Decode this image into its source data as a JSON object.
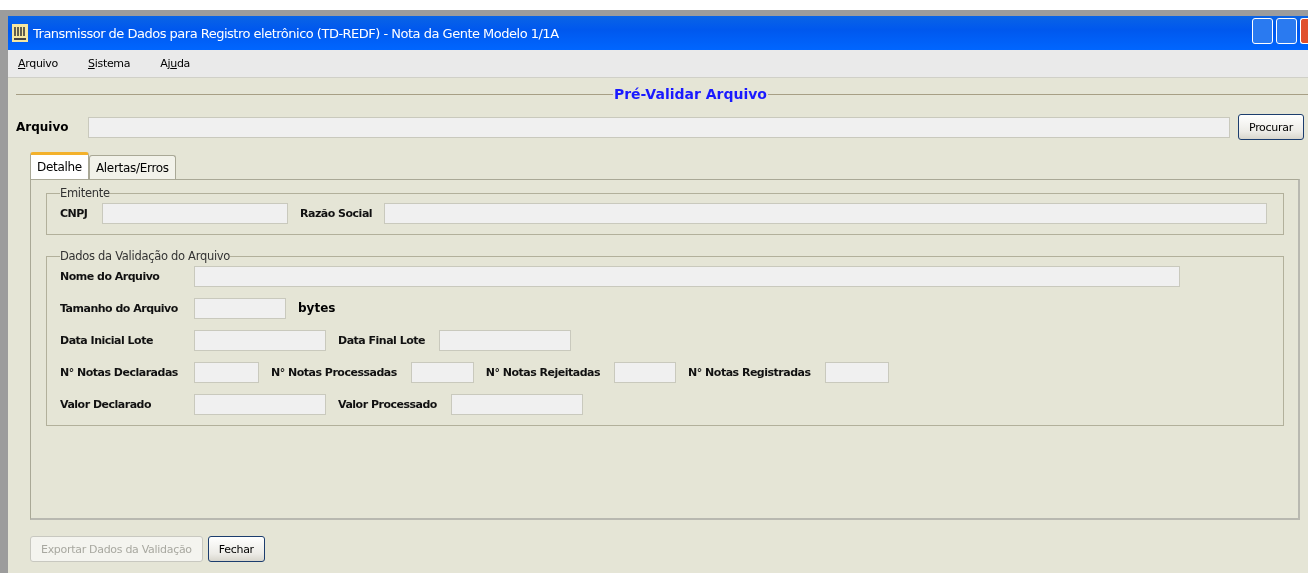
{
  "window": {
    "title": "Transmissor de Dados para Registro eletrônico (TD-REDF) - Nota da Gente Modelo 1/1A"
  },
  "menu": [
    {
      "label": "Arquivo"
    },
    {
      "label": "Sistema"
    },
    {
      "label": "Ajuda"
    }
  ],
  "panel_title": "Pré-Validar Arquivo",
  "file_row": {
    "label": "Arquivo",
    "button": "Procurar"
  },
  "tabs": [
    {
      "label": "Detalhe",
      "selected": true
    },
    {
      "label": "Alertas/Erros",
      "selected": false
    }
  ],
  "groups": [
    {
      "title": "Emitente",
      "rows": [
        [
          {
            "kind": "label",
            "text": "CNPJ"
          },
          {
            "kind": "field"
          },
          {
            "kind": "label",
            "text": "Razão Social"
          },
          {
            "kind": "field"
          }
        ]
      ]
    },
    {
      "title": "Dados da Validação do Arquivo",
      "rows": [
        [
          {
            "kind": "label",
            "text": "Nome do Arquivo"
          },
          {
            "kind": "field"
          }
        ],
        [
          {
            "kind": "label",
            "text": "Tamanho do Arquivo"
          },
          {
            "kind": "field"
          },
          {
            "kind": "unit",
            "text": "bytes"
          }
        ],
        [
          {
            "kind": "label",
            "text": "Data Inicial Lote"
          },
          {
            "kind": "field"
          },
          {
            "kind": "label",
            "text": "Data Final Lote"
          },
          {
            "kind": "field"
          }
        ],
        [
          {
            "kind": "label",
            "text": "N° Notas Declaradas"
          },
          {
            "kind": "field"
          },
          {
            "kind": "label",
            "text": "N° Notas Processadas"
          },
          {
            "kind": "field"
          },
          {
            "kind": "label",
            "text": "N° Notas Rejeitadas"
          },
          {
            "kind": "field"
          },
          {
            "kind": "label",
            "text": "N° Notas Registradas"
          },
          {
            "kind": "field"
          }
        ],
        [
          {
            "kind": "label",
            "text": "Valor Declarado"
          },
          {
            "kind": "field"
          },
          {
            "kind": "label",
            "text": "Valor Processado"
          },
          {
            "kind": "field"
          }
        ]
      ]
    }
  ],
  "buttons": [
    {
      "label": "Exportar Dados da Validação",
      "disabled": true
    },
    {
      "label": "Fechar",
      "disabled": false
    }
  ]
}
